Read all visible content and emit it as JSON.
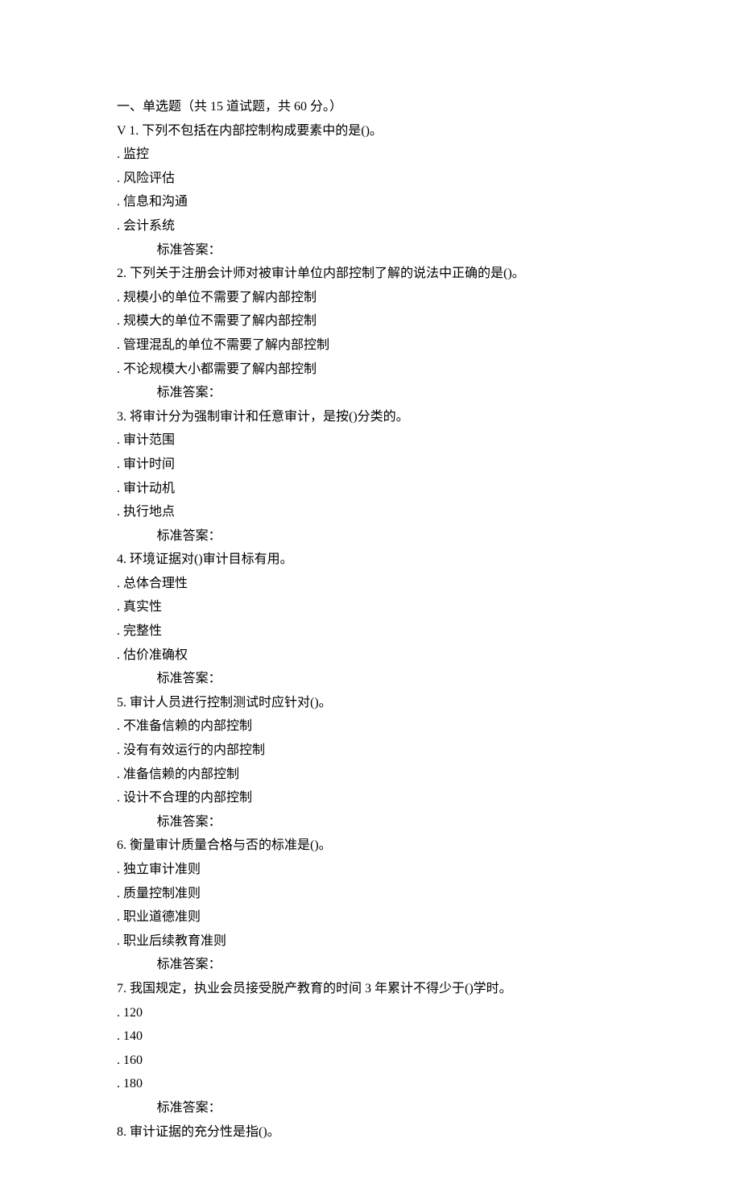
{
  "section_header": "一、单选题（共 15 道试题，共 60 分。）",
  "answer_label": "标准答案：",
  "questions": [
    {
      "stem_prefix": "V 1.",
      "stem": "下列不包括在内部控制构成要素中的是()。",
      "options": [
        "监控",
        "风险评估",
        "信息和沟通",
        "会计系统"
      ]
    },
    {
      "stem_prefix": "2.",
      "stem": "下列关于注册会计师对被审计单位内部控制了解的说法中正确的是()。",
      "options": [
        "规模小的单位不需要了解内部控制",
        "规模大的单位不需要了解内部控制",
        "管理混乱的单位不需要了解内部控制",
        "不论规模大小都需要了解内部控制"
      ]
    },
    {
      "stem_prefix": "3.",
      "stem": "将审计分为强制审计和任意审计，是按()分类的。",
      "options": [
        "审计范围",
        "审计时间",
        "审计动机",
        "执行地点"
      ]
    },
    {
      "stem_prefix": "4.",
      "stem": "环境证据对()审计目标有用。",
      "options": [
        "总体合理性",
        "真实性",
        "完整性",
        "估价准确权"
      ]
    },
    {
      "stem_prefix": "5.",
      "stem": "审计人员进行控制测试时应针对()。",
      "options": [
        "不准备信赖的内部控制",
        "没有有效运行的内部控制",
        "准备信赖的内部控制",
        "设计不合理的内部控制"
      ]
    },
    {
      "stem_prefix": "6.",
      "stem": "衡量审计质量合格与否的标准是()。",
      "options": [
        "独立审计准则",
        "质量控制准则",
        "职业道德准则",
        "职业后续教育准则"
      ]
    },
    {
      "stem_prefix": "7.",
      "stem": "我国规定，执业会员接受脱产教育的时间 3 年累计不得少于()学时。",
      "options": [
        "120",
        "140",
        "160",
        "180"
      ]
    },
    {
      "stem_prefix": "8.",
      "stem": "审计证据的充分性是指()。",
      "options": []
    }
  ]
}
